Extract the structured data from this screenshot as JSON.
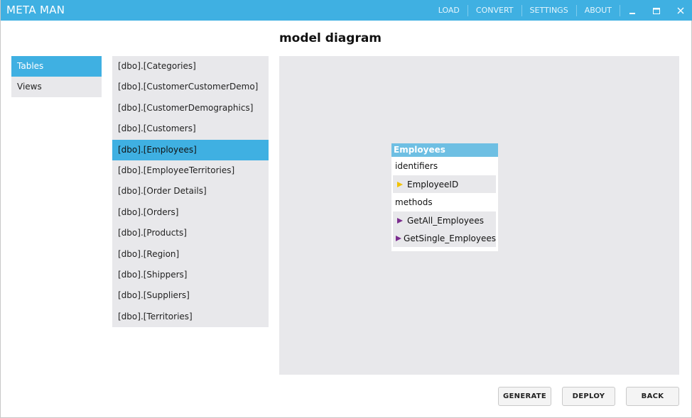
{
  "app": {
    "title": "META MAN"
  },
  "menu": {
    "load": "LOAD",
    "convert": "CONVERT",
    "settings": "SETTINGS",
    "about": "ABOUT"
  },
  "page": {
    "title": "model diagram"
  },
  "nav": {
    "items": [
      {
        "label": "Tables",
        "active": true
      },
      {
        "label": "Views",
        "active": false
      }
    ]
  },
  "tables": {
    "selected": "[dbo].[Employees]",
    "items": [
      "[dbo].[Categories]",
      "[dbo].[CustomerCustomerDemo]",
      "[dbo].[CustomerDemographics]",
      "[dbo].[Customers]",
      "[dbo].[Employees]",
      "[dbo].[EmployeeTerritories]",
      "[dbo].[Order Details]",
      "[dbo].[Orders]",
      "[dbo].[Products]",
      "[dbo].[Region]",
      "[dbo].[Shippers]",
      "[dbo].[Suppliers]",
      "[dbo].[Territories]"
    ]
  },
  "entity": {
    "name": "Employees",
    "identifiers_label": "identifiers",
    "identifiers": [
      "EmployeeID"
    ],
    "methods_label": "methods",
    "methods": [
      "GetAll_Employees",
      "GetSingle_Employees"
    ]
  },
  "actions": {
    "generate": "GENERATE",
    "deploy": "DEPLOY",
    "back": "BACK"
  },
  "colors": {
    "accent": "#3fb0e2",
    "entity_header": "#6ebfe3",
    "panel_bg": "#e8e8eb",
    "identifier_marker": "#f2c200",
    "method_marker": "#7b2d8e"
  }
}
